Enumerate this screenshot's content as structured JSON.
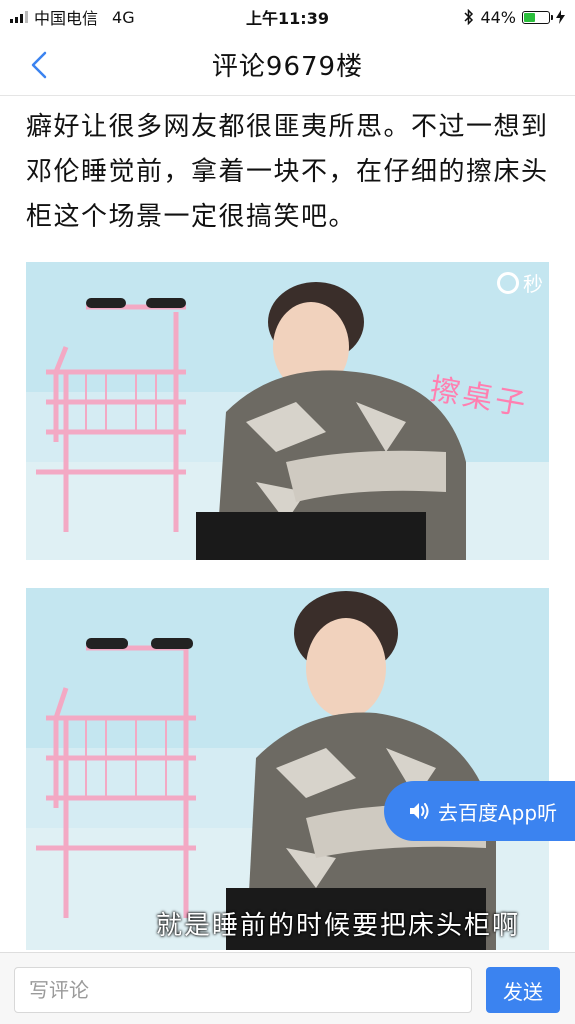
{
  "status_bar": {
    "carrier": "中国电信",
    "network": "4G",
    "time": "上午11:39",
    "battery_percent": "44%",
    "battery_level": 0.44,
    "bluetooth_icon": "bluetooth-icon",
    "charging_icon": "charging-bolt-icon"
  },
  "nav": {
    "title": "评论9679楼",
    "back_icon": "chevron-left-icon"
  },
  "article": {
    "paragraph": "癖好让很多网友都很匪夷所思。不过一想到邓伦睡觉前，拿着一块不，在仔细的擦床头柜这个场景一定很搞笑吧。",
    "photo1": {
      "overlay_text": "擦桌子",
      "watermark": "秒"
    },
    "photo2": {
      "subtitle": "就是睡前的时候要把床头柜啊"
    }
  },
  "listen_button": {
    "label": "去百度App听",
    "icon": "speaker-icon"
  },
  "bottom_bar": {
    "input_placeholder": "写评论",
    "send_label": "发送"
  },
  "colors": {
    "accent": "#3b83f0",
    "battery": "#2bbf3c"
  }
}
